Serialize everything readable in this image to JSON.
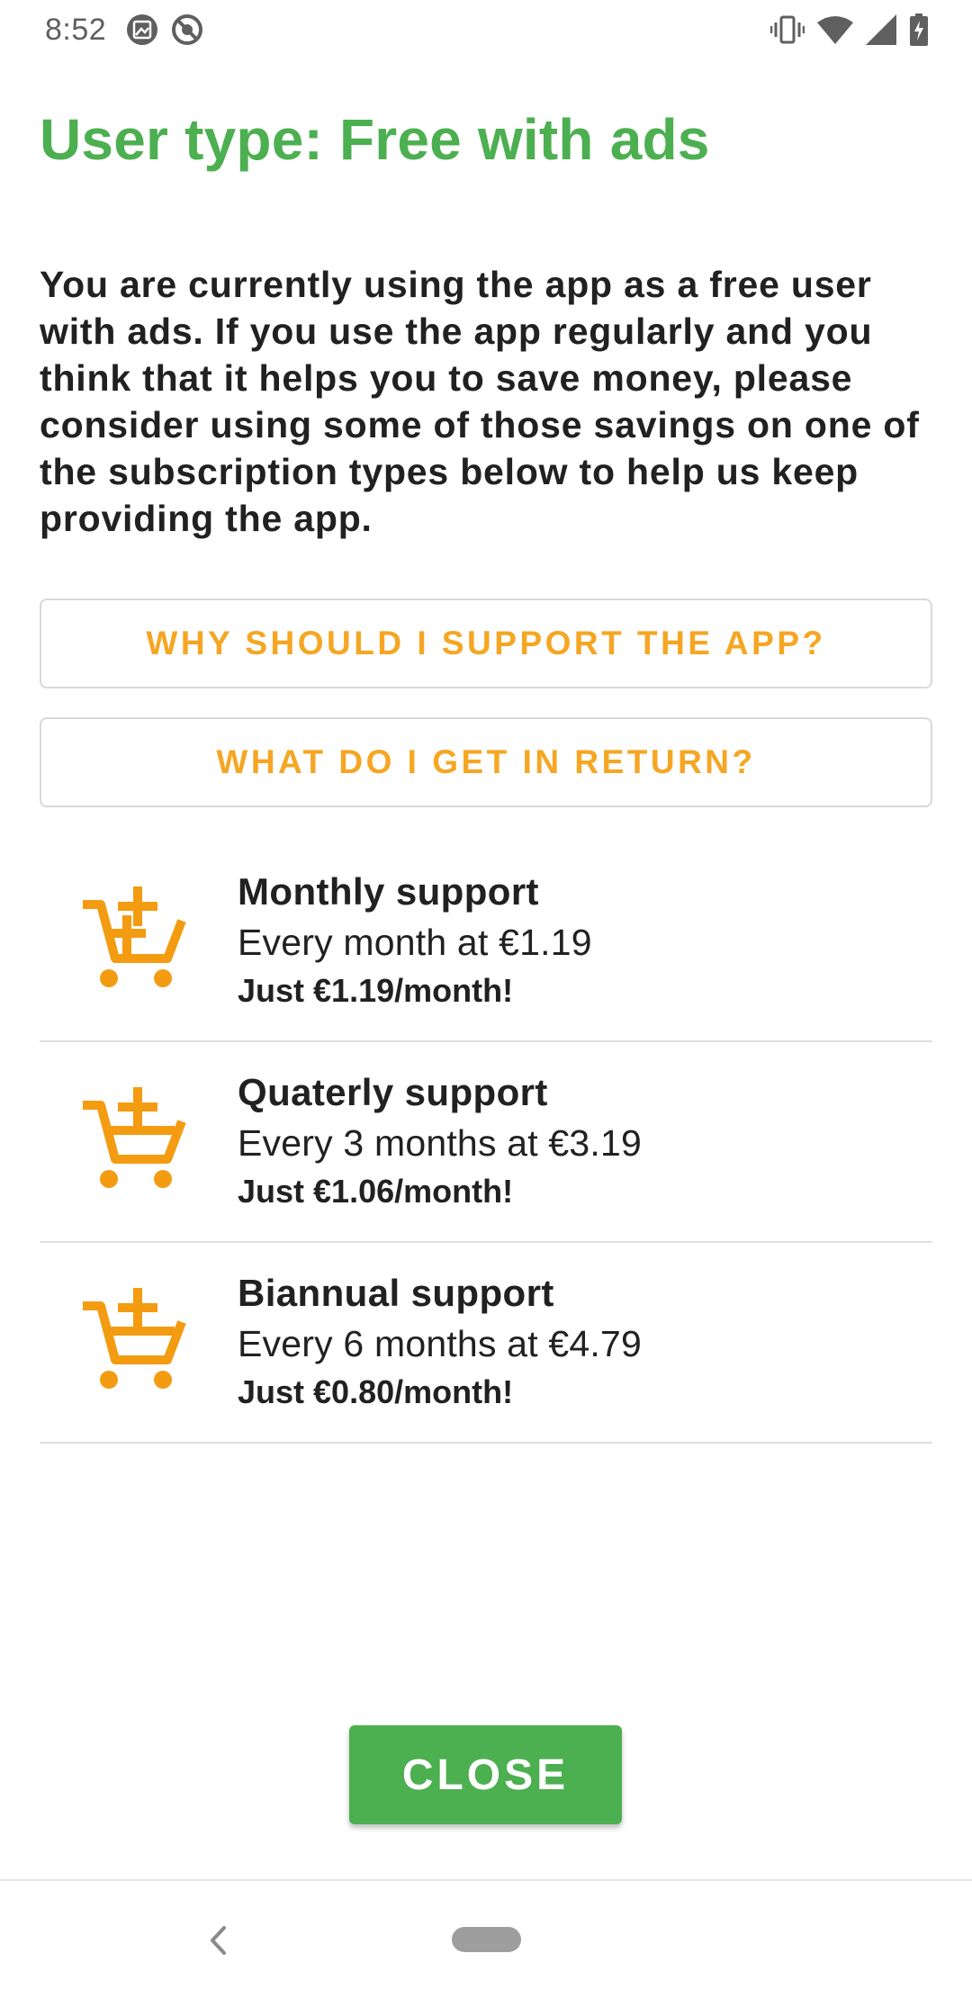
{
  "status_bar": {
    "time": "8:52",
    "left_icons": [
      "image-notification-icon",
      "do-not-disturb-icon"
    ],
    "right_icons": [
      "vibrate-icon",
      "wifi-icon",
      "cellular-signal-icon",
      "battery-charging-icon"
    ]
  },
  "title": "User type: Free with ads",
  "description": "You are currently using the app as a free user with ads. If you use the app regularly and you think that it helps you to save money, please consider using some of those savings on one of the subscription types below to help us keep providing the app.",
  "buttons": {
    "why": "WHY SHOULD I SUPPORT THE APP?",
    "what": "WHAT DO I GET IN RETURN?"
  },
  "subscriptions": [
    {
      "icon": "add-to-cart-icon",
      "name": "Monthly support",
      "price": "Every month at €1.19",
      "per_month": "Just €1.19/month!"
    },
    {
      "icon": "add-to-cart-icon",
      "name": "Quaterly support",
      "price": "Every 3 months at €3.19",
      "per_month": "Just €1.06/month!"
    },
    {
      "icon": "add-to-cart-icon",
      "name": "Biannual support",
      "price": "Every 6 months at €4.79",
      "per_month": "Just €0.80/month!"
    }
  ],
  "close_label": "CLOSE",
  "colors": {
    "title_green": "#4caf50",
    "accent_orange": "#f5a623",
    "cart_orange": "#f39c12",
    "button_green": "#4caf50"
  },
  "nav_bar": {
    "icons": [
      "back-icon",
      "home-pill-icon"
    ]
  }
}
